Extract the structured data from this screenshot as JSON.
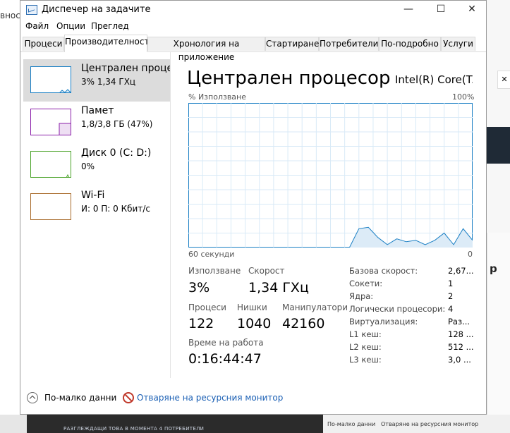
{
  "window": {
    "title": "Диспечер на задачите"
  },
  "menu": [
    "Файл",
    "Опции",
    "Преглед"
  ],
  "tabs": [
    "Процеси",
    "Производителност",
    "Хронология на приложение",
    "Стартиране",
    "Потребители",
    "По-подробно",
    "Услуги"
  ],
  "active_tab": "Производителност",
  "sidebar": [
    {
      "name": "Централен процесор",
      "sub": "3%  1,34 ГХц",
      "color": "#1a7fc4",
      "selected": true
    },
    {
      "name": "Памет",
      "sub": "1,8/3,8 ГБ (47%)",
      "color": "#8b1fa9",
      "selected": false
    },
    {
      "name": "Диск 0 (C: D:)",
      "sub": "0%",
      "color": "#4aa329",
      "selected": false
    },
    {
      "name": "Wi-Fi",
      "sub": "И: 0 П: 0 Кбит/с",
      "color": "#a86a2a",
      "selected": false
    }
  ],
  "main": {
    "title": "Централен процесор",
    "cpu_model": "Intel(R) Core(T...",
    "usage_label": "% Използване",
    "usage_max": "100%",
    "x_label": "60 секунди",
    "x_zero": "0"
  },
  "stats": {
    "usage_label": "Използване",
    "usage_val": "3%",
    "speed_label": "Скорост",
    "speed_val": "1,34 ГХц",
    "proc_label": "Процеси",
    "proc_val": "122",
    "threads_label": "Нишки",
    "threads_val": "1040",
    "handles_label": "Манипулатори",
    "handles_val": "42160",
    "uptime_label": "Време на работа",
    "uptime_val": "0:16:44:47"
  },
  "specs": [
    {
      "k": "Базова скорост:",
      "v": "2,67..."
    },
    {
      "k": "Сокети:",
      "v": "1"
    },
    {
      "k": "Ядра:",
      "v": "2"
    },
    {
      "k": "Логически процесори:",
      "v": "4"
    },
    {
      "k": "Виртуализация:",
      "v": "Раз..."
    },
    {
      "k": "L1 кеш:",
      "v": "128 ..."
    },
    {
      "k": "L2 кеш:",
      "v": "512 ..."
    },
    {
      "k": "L3 кеш:",
      "v": "3,0 ..."
    }
  ],
  "footer": {
    "fewer": "По-малко данни",
    "monitor": "Отваряне на ресурсния монитор"
  },
  "chart_data": {
    "type": "area",
    "ylim": [
      0,
      100
    ],
    "x": [
      60,
      55,
      50,
      45,
      40,
      35,
      30,
      26,
      24,
      22,
      20,
      18,
      16,
      14,
      12,
      10,
      8,
      6,
      4,
      2,
      0
    ],
    "values": [
      0,
      0,
      0,
      0,
      0,
      0,
      0,
      0,
      13,
      14,
      7,
      2,
      6,
      4,
      5,
      2,
      5,
      10,
      2,
      13,
      5
    ],
    "color": "#1a7fc4"
  },
  "background": {
    "left_text": "вност",
    "bottom_text": "РАЗГЛЕЖДАЩИ ТОВА В МОМЕНТА  4 ПОТРЕБИТЕЛИ",
    "right_strip_fewer": "По-малко данни",
    "right_strip_monitor": "Отваряне на ресурсния монитор",
    "right_letter": "р"
  }
}
